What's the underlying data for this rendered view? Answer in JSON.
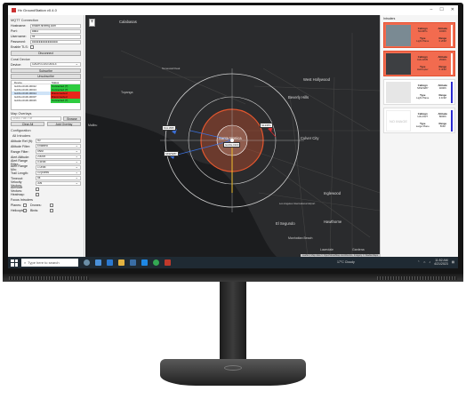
{
  "window": {
    "title": "Hx GroundStation v0.4.0",
    "controls": [
      "–",
      "☐",
      "✕"
    ]
  },
  "mqtt": {
    "section": "MQTT Connection",
    "hostname_label": "Hostname:",
    "hostname": "broker.hivemq.com",
    "port_label": "Port:",
    "port": "8883",
    "username_label": "Username:",
    "username": "hx",
    "password_label": "Password:",
    "password": "●●●●●●●●●●●●●●●",
    "tls_label": "Enable TLS:",
    "button": "Disconnect"
  },
  "coral": {
    "section": "Coral Device",
    "device_label": "Device:",
    "device": "GAOH-0100-00014",
    "subscribe": "Subscribe",
    "unsubscribe": "Unsubscribe",
    "col_device": "Device",
    "col_status": "Status",
    "devices": [
      {
        "name": "GAOH-0100-00012",
        "status": "Connected (?)",
        "state": "ok"
      },
      {
        "name": "GAOH-0100-00013",
        "status": "Connected (?)",
        "state": "ok"
      },
      {
        "name": "GAOH-0100-00014",
        "status": "Disconnected",
        "state": "bad"
      },
      {
        "name": "GAOH-0100-00007",
        "status": "Disconnected",
        "state": "bad"
      },
      {
        "name": "GAOH-0100-00015",
        "status": "Connected (?)",
        "state": "ok"
      }
    ]
  },
  "overlays": {
    "section": "Map Overlays",
    "path_placeholder": "Select Path File",
    "browse": "Browse",
    "clear_all": "Clear All",
    "add_overlay": "Add Overlay"
  },
  "config": {
    "section": "Configuration",
    "subsection": "All Intruders",
    "rows": [
      {
        "label": "Altitude Ref (ft):",
        "value": "50",
        "type": "text"
      },
      {
        "label": "Altitude Filter:",
        "value": "Enabled",
        "type": "select"
      },
      {
        "label": "Range Filter:",
        "value": "5NM",
        "type": "select"
      },
      {
        "label": "Alert Altitude:",
        "value": "2000ft",
        "type": "select"
      },
      {
        "label": "Alert Range Filter:",
        "value": "0.5NM",
        "type": "select"
      },
      {
        "label": "Alert Range Min:",
        "value": "1.0NM",
        "type": "select"
      },
      {
        "label": "Trail Length:",
        "value": "10 points",
        "type": "select"
      },
      {
        "label": "Timeout:",
        "value": "5s",
        "type": "select"
      },
      {
        "label": "Velocity Vectors:",
        "value": "30s",
        "type": "select"
      }
    ],
    "airmode_label": "Airmode Vectors:",
    "heatmap_label": "Heatmap:",
    "focus_label": "Focus Intruders",
    "planes_label": "Planes:",
    "drones_label": "Drones:",
    "helicopters_label": "Helicopters:",
    "birds_label": "Birds:"
  },
  "map": {
    "zoom": "+",
    "labels": [
      "Calabasas",
      "Topanga",
      "Beverly Hills",
      "West Hollywood",
      "Culver City",
      "Malibu",
      "Santa Monica",
      "Inglewood",
      "El Segundo",
      "Hawthorne",
      "Manhattan Beach",
      "Lawndale",
      "Gardena",
      "Los Angeles International Airport",
      "Temescal Peak"
    ],
    "aircraft": [
      {
        "tag": "DAL1835",
        "color": "#3b6fd8"
      },
      {
        "tag": "N123PG",
        "color": "#d8282c"
      },
      {
        "tag": "SKW3287",
        "color": "#3b6fd8"
      },
      {
        "tag": "GAOH-0100",
        "color": "#ffffff"
      }
    ],
    "attribution": "Leaflet | Map data © OpenStreetMap contributors, Imagery © Stadia Maps"
  },
  "intruders": {
    "title": "Intruders",
    "cards": [
      {
        "callsign_label": "Callsign",
        "callsign": "N123PG",
        "alt_label": "Altitude",
        "alt": "1600ft",
        "type_label": "Type",
        "type": "Light Plane",
        "range_label": "Range",
        "range": "0.2NM",
        "alert": true
      },
      {
        "callsign_label": "Callsign",
        "callsign": "DAL1835",
        "alt_label": "Altitude",
        "alt": "2500ft",
        "type_label": "Type",
        "type": "Helicopter",
        "range_label": "Range",
        "range": "0.4NM",
        "alert": true
      },
      {
        "callsign_label": "Callsign",
        "callsign": "SKW3287",
        "alt_label": "Altitude",
        "alt": "4000ft",
        "type_label": "Type",
        "type": "Light Plane",
        "range_label": "Range",
        "range": "2.1NM",
        "alert": false
      },
      {
        "callsign_label": "Callsign",
        "callsign": "UAL1927",
        "alt_label": "Altitude",
        "alt": "8000ft",
        "type_label": "Type",
        "type": "Large Plane",
        "range_label": "Range",
        "range": "5NM",
        "alert": false,
        "noimage": "NO IMAGE"
      }
    ]
  },
  "taskbar": {
    "search": "Type here to search",
    "weather": "17°C  Cloudy",
    "time": "11:52 AM",
    "date": "4/21/2023"
  },
  "colors": {
    "alert": "#f26b4f",
    "ok": "#2ecc40",
    "bad": "#e8261b",
    "range_ring": "#e4572e",
    "track": "#f2c230"
  }
}
